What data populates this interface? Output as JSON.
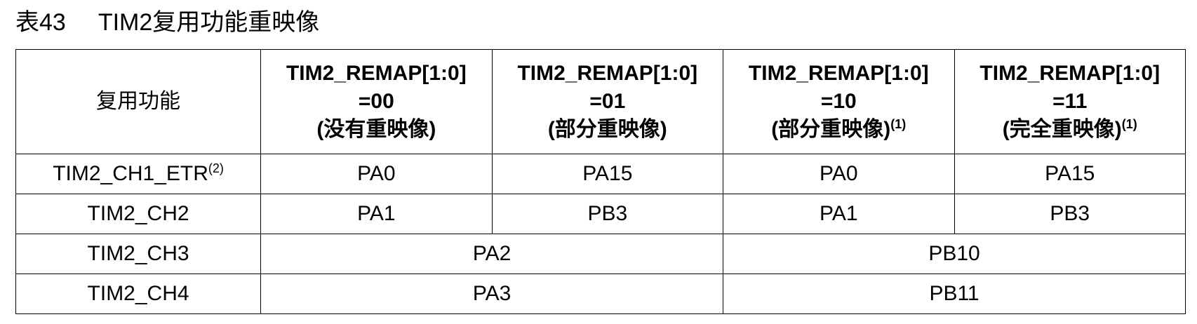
{
  "caption": {
    "number": "表43",
    "title": "TIM2复用功能重映像"
  },
  "table": {
    "feature_header": "复用功能",
    "remap_headers": [
      {
        "line1": "TIM2_REMAP[1:0]",
        "line2": "=00",
        "line3": "(没有重映像)",
        "note": ""
      },
      {
        "line1": "TIM2_REMAP[1:0]",
        "line2": "=01",
        "line3": "(部分重映像)",
        "note": ""
      },
      {
        "line1": "TIM2_REMAP[1:0]",
        "line2": "=10",
        "line3": "(部分重映像)",
        "note": "(1)"
      },
      {
        "line1": "TIM2_REMAP[1:0]",
        "line2": "=11",
        "line3": "(完全重映像)",
        "note": "(1)"
      }
    ],
    "rows": [
      {
        "feature": "TIM2_CH1_ETR",
        "feature_note": "(2)",
        "cells": [
          "PA0",
          "PA15",
          "PA0",
          "PA15"
        ]
      },
      {
        "feature": "TIM2_CH2",
        "feature_note": "",
        "cells": [
          "PA1",
          "PB3",
          "PA1",
          "PB3"
        ]
      },
      {
        "feature": "TIM2_CH3",
        "feature_note": "",
        "cells": [
          "PA2",
          "PB10"
        ]
      },
      {
        "feature": "TIM2_CH4",
        "feature_note": "",
        "cells": [
          "PA3",
          "PB11"
        ]
      }
    ]
  }
}
